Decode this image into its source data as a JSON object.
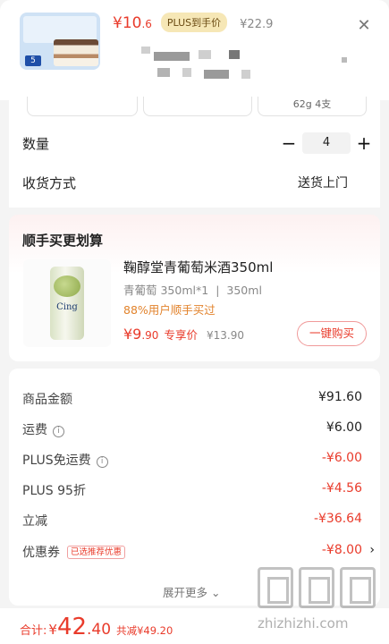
{
  "header": {
    "price_int": "¥10",
    "price_dec": ".6",
    "plus_badge": "PLUS到手价",
    "orig_price": "¥22.9"
  },
  "spec": {
    "chip_text": "62g 4支"
  },
  "quantity": {
    "label": "数量",
    "value": "4"
  },
  "delivery": {
    "label": "收货方式",
    "value": "送货上门"
  },
  "recommend": {
    "title": "顺手买更划算",
    "can_text": "Cing",
    "name": "鞠醇堂青葡萄米酒350ml",
    "spec_a": "青葡萄 350ml*1",
    "spec_b": "350ml",
    "buyers": "88%用户顺手买过",
    "price_int": "¥9",
    "price_dec": ".90",
    "price_label": "专享价",
    "orig_price": "¥13.90",
    "buy_button": "一键购买"
  },
  "cost": {
    "rows": [
      {
        "label": "商品金额",
        "value": "¥91.60"
      },
      {
        "label": "运费",
        "value": "¥6.00"
      },
      {
        "label": "PLUS免运费",
        "value": "-¥6.00"
      },
      {
        "label": "PLUS 95折",
        "value": "-¥4.56"
      },
      {
        "label": "立减",
        "value": "-¥36.64"
      },
      {
        "label": "优惠券",
        "value": "-¥8.00"
      }
    ],
    "coupon_tag": "已选推荐优惠",
    "expand": "展开更多"
  },
  "footer": {
    "label": "合计:",
    "currency": "¥",
    "int": "42",
    "dec": ".40",
    "saved": "共减¥49.20"
  },
  "watermark": {
    "url": "zhizhizhi.com"
  },
  "colors": {
    "accent": "#e93b2b",
    "orange": "#e2832c"
  }
}
